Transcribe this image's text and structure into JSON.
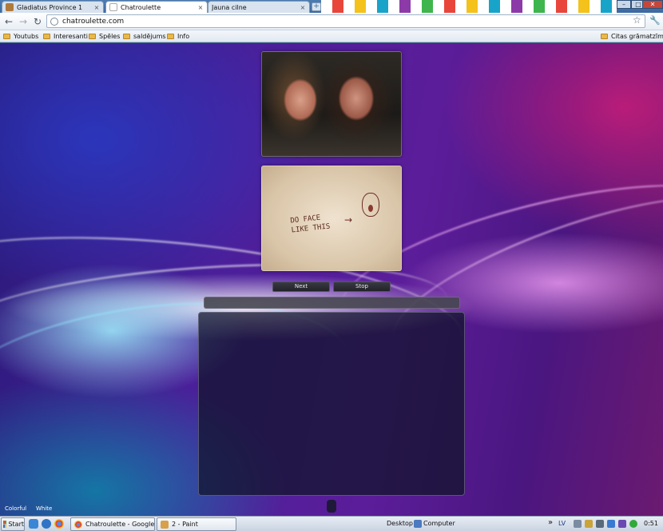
{
  "browser": {
    "tabs": [
      {
        "label": "Gladiatus Province 1",
        "active": false,
        "close": "×"
      },
      {
        "label": "Chatroulette",
        "active": true,
        "close": "×"
      },
      {
        "label": "Jauna cilne",
        "active": false,
        "close": "×"
      }
    ],
    "new_tab": "+",
    "window_controls": {
      "minimize": "–",
      "maximize": "□",
      "close": "✕"
    },
    "nav": {
      "back": "←",
      "forward": "→",
      "reload": "↻"
    },
    "url": "chatroulette.com",
    "star": "☆",
    "wrench": "🔧",
    "bookmarks": [
      "Youtubs",
      "Interesanti",
      "Spēles",
      "saldējums",
      "Info"
    ],
    "other_bookmarks": "Citas grāmatzīmes"
  },
  "page": {
    "drawing_text": [
      "DO FACE",
      "LIKE THIS"
    ],
    "drawing_arrow": "→",
    "buttons": {
      "next": "Next",
      "stop": "Stop"
    },
    "themes": {
      "colorful": "Colorful",
      "white": "White"
    }
  },
  "taskbar": {
    "start": "Start",
    "tasks": [
      "Chatroulette - Google C...",
      "2 - Paint"
    ],
    "desktop": "Desktop",
    "computer": "Computer",
    "chevron": "»",
    "language": "LV",
    "clock": "0:51"
  },
  "colors": {
    "accent": "#3d6aa0",
    "page_purple": "#4b1f9a",
    "page_magenta": "#dc1e78",
    "page_cyan": "#78dcff"
  }
}
